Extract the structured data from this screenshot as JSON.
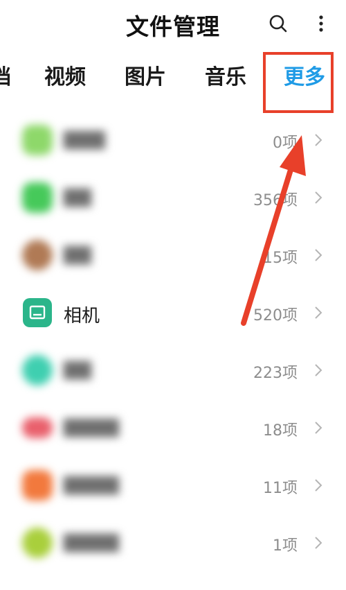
{
  "header": {
    "title": "文件管理",
    "search_icon": "search-icon",
    "more_icon": "more-vertical-icon"
  },
  "tabs": [
    {
      "label": "档",
      "active": false
    },
    {
      "label": "视频",
      "active": false
    },
    {
      "label": "图片",
      "active": false
    },
    {
      "label": "音乐",
      "active": false
    },
    {
      "label": "更多",
      "active": true
    }
  ],
  "colors": {
    "accent": "#1f9be6",
    "annotation_red": "#e8402a",
    "camera_icon": "#2bb58a"
  },
  "list": [
    {
      "name": "",
      "count": "0项",
      "icon_color": "#8ed86a",
      "blurred": true
    },
    {
      "name": "",
      "count": "356项",
      "icon_color": "#46c95a",
      "blurred": true
    },
    {
      "name": "",
      "count": "15项",
      "icon_color": "#b07a55",
      "blurred": true
    },
    {
      "name": "相机",
      "count": "520项",
      "icon_color": "#2bb58a",
      "blurred": false
    },
    {
      "name": "",
      "count": "223项",
      "icon_color": "#3fcfb0",
      "blurred": true
    },
    {
      "name": "",
      "count": "18项",
      "icon_color": "#e9606c",
      "blurred": true
    },
    {
      "name": "",
      "count": "11项",
      "icon_color": "#f2793d",
      "blurred": true
    },
    {
      "name": "",
      "count": "1项",
      "icon_color": "#a9cf3c",
      "blurred": true
    }
  ]
}
